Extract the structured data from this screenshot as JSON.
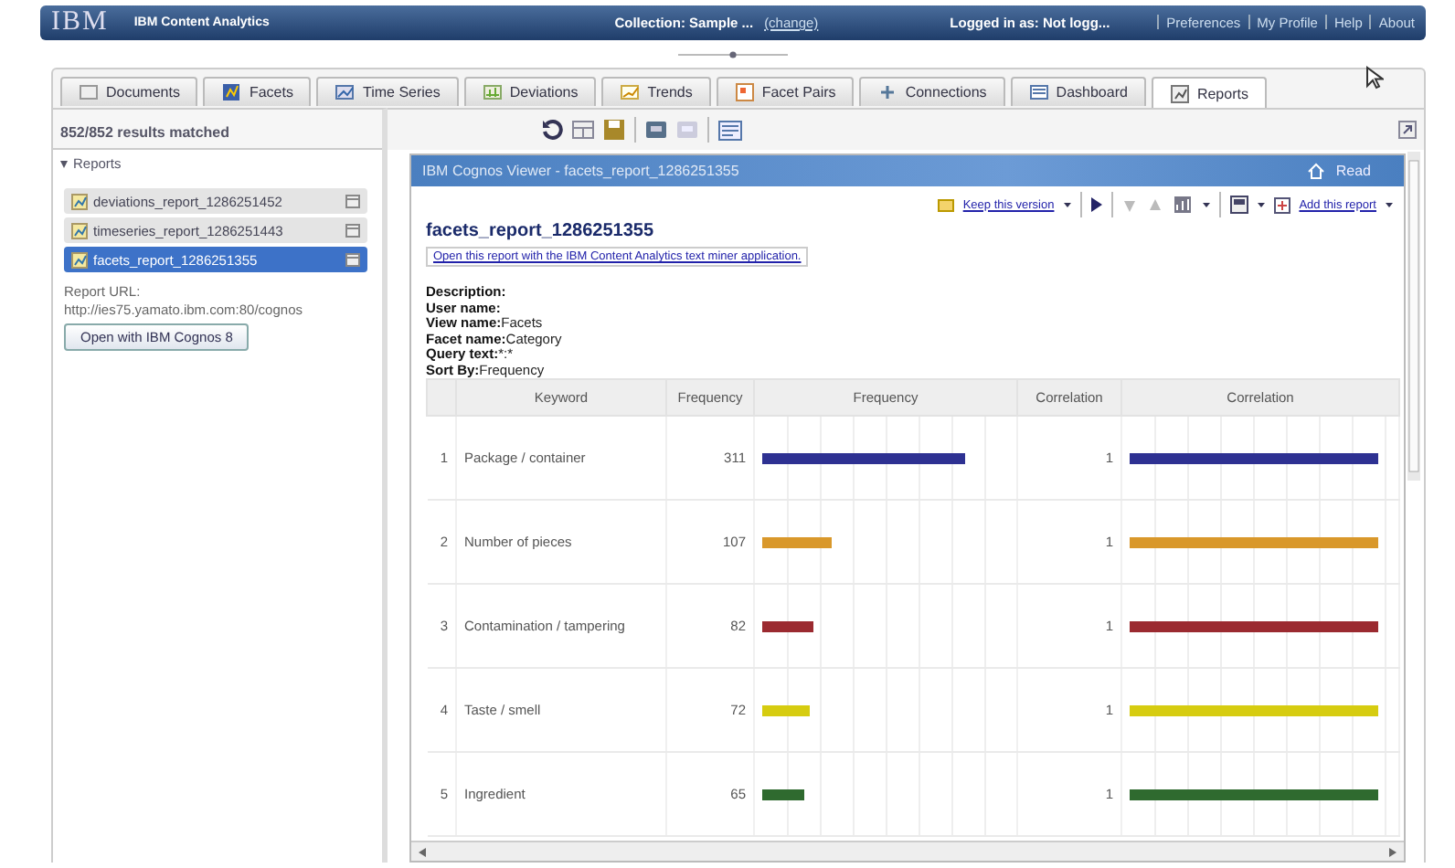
{
  "header": {
    "logo": "IBM",
    "product": "IBM Content Analytics",
    "collection_label": "Collection: Sample ...",
    "collection_link": "(change)",
    "logged_in": "Logged in as: Not logg...",
    "links": [
      "Preferences",
      "My Profile",
      "Help",
      "About"
    ]
  },
  "tabs": [
    {
      "label": "Documents",
      "selected": false
    },
    {
      "label": "Facets",
      "selected": false
    },
    {
      "label": "Time Series",
      "selected": false
    },
    {
      "label": "Deviations",
      "selected": false
    },
    {
      "label": "Trends",
      "selected": false
    },
    {
      "label": "Facet Pairs",
      "selected": false
    },
    {
      "label": "Connections",
      "selected": false
    },
    {
      "label": "Dashboard",
      "selected": false
    },
    {
      "label": "Reports",
      "selected": true
    }
  ],
  "sidebar": {
    "results": "852/852 results matched",
    "section": {
      "label": "Reports",
      "expanded": true
    },
    "items": [
      {
        "label": "deviations_report_1286251452",
        "selected": false
      },
      {
        "label": "timeseries_report_1286251443",
        "selected": false
      },
      {
        "label": "facets_report_1286251355",
        "selected": true
      }
    ],
    "url_label": "Report URL:",
    "url": "http://ies75.yamato.ibm.com:80/cognos",
    "open_button": "Open with IBM Cognos 8"
  },
  "viewer": {
    "title": "IBM Cognos Viewer - facets_report_1286251355",
    "home": "Read",
    "keep_version": "Keep this version",
    "add_report": "Add this report",
    "report_title": "facets_report_1286251355",
    "open_link": "Open this report with the IBM Content Analytics text miner application.",
    "meta": [
      {
        "label": "Description:"
      },
      {
        "label": "User name:"
      },
      {
        "label": "View name:",
        "value": "Facets"
      },
      {
        "label": "Facet name:",
        "value": "Category"
      },
      {
        "label": "Query text:",
        "value": "*:*"
      },
      {
        "label": "Sort By:",
        "value": "Frequency"
      }
    ],
    "table": {
      "columns": [
        "Keyword",
        "Frequency",
        "Frequency",
        "Correlation",
        "Correlation"
      ],
      "rows": [
        {
          "index": "1",
          "keyword": "Package / container",
          "frequency": "311",
          "frequency_bar": {
            "level": 0.82
          },
          "correlation": "1",
          "correlation_bar": {
            "level": 0.95
          },
          "color": "#2e3192"
        },
        {
          "index": "2",
          "keyword": "Number of pieces",
          "frequency": "107",
          "frequency_bar": {
            "level": 0.28
          },
          "correlation": "1",
          "correlation_bar": {
            "level": 0.95
          },
          "color": "#d9982b"
        },
        {
          "index": "3",
          "keyword": "Contamination / tampering",
          "frequency": "82",
          "frequency_bar": {
            "level": 0.21
          },
          "correlation": "1",
          "correlation_bar": {
            "level": 0.95
          },
          "color": "#9b2a30"
        },
        {
          "index": "4",
          "keyword": "Taste / smell",
          "frequency": "72",
          "frequency_bar": {
            "level": 0.19
          },
          "correlation": "1",
          "correlation_bar": {
            "level": 0.95
          },
          "color": "#d6cc10"
        },
        {
          "index": "5",
          "keyword": "Ingredient",
          "frequency": "65",
          "frequency_bar": {
            "level": 0.17
          },
          "correlation": "1",
          "correlation_bar": {
            "level": 0.95
          },
          "color": "#2f6a2f"
        }
      ]
    }
  }
}
